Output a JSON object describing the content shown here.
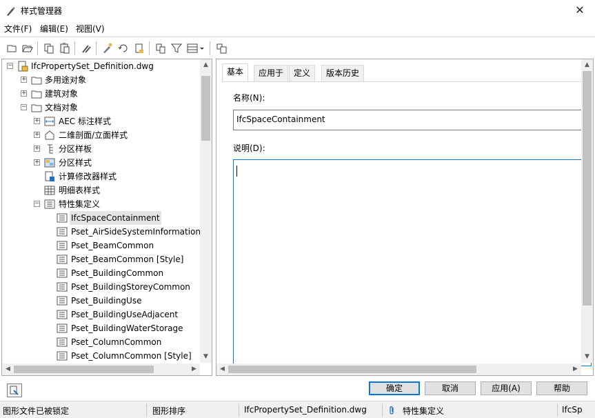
{
  "window": {
    "title": "样式管理器",
    "close_glyph": "✕"
  },
  "menu": [
    "文件(F)",
    "编辑(E)",
    "视图(V)"
  ],
  "toolbar": {
    "icons": [
      "new-icon",
      "open-icon",
      "copy-icon",
      "paste-icon",
      "purge-icon",
      "edit-style-icon",
      "set-from-icon",
      "edit-icon",
      "sort-icon",
      "filter-icon",
      "view-icon",
      "toggle-view-icon"
    ]
  },
  "tree": {
    "root": "IfcPropertySet_Definition.dwg",
    "nodes": [
      {
        "label": "多用途对象",
        "toggle": "+",
        "level": 1
      },
      {
        "label": "建筑对象",
        "toggle": "+",
        "level": 1
      },
      {
        "label": "文档对象",
        "toggle": "−",
        "level": 1
      },
      {
        "label": "AEC 标注样式",
        "toggle": "+",
        "level": 2
      },
      {
        "label": "二维剖面/立面样式",
        "toggle": "+",
        "level": 2
      },
      {
        "label": "分区样板",
        "toggle": "+",
        "level": 2
      },
      {
        "label": "分区样式",
        "toggle": "+",
        "level": 2
      },
      {
        "label": "计算修改器样式",
        "toggle": "",
        "level": 2
      },
      {
        "label": "明细表样式",
        "toggle": "",
        "level": 2
      },
      {
        "label": "特性集定义",
        "toggle": "−",
        "level": 2
      }
    ],
    "leaves": [
      "IfcSpaceContainment",
      "Pset_AirSideSystemInformation",
      "Pset_BeamCommon",
      "Pset_BeamCommon [Style]",
      "Pset_BuildingCommon",
      "Pset_BuildingStoreyCommon",
      "Pset_BuildingUse",
      "Pset_BuildingUseAdjacent",
      "Pset_BuildingWaterStorage",
      "Pset_ColumnCommon",
      "Pset_ColumnCommon [Style]"
    ],
    "selected": "IfcSpaceContainment"
  },
  "tabs": [
    "基本",
    "应用于",
    "定义",
    "版本历史"
  ],
  "active_tab": "基本",
  "form": {
    "name_label": "名称(N):",
    "name_value": "IfcSpaceContainment",
    "desc_label": "说明(D):",
    "desc_value": ""
  },
  "buttons": {
    "ok": "确定",
    "cancel": "取消",
    "apply": "应用(A)",
    "help": "帮助"
  },
  "status": {
    "lock": "图形文件已被锁定",
    "sort": "图形排序",
    "file": "IfcPropertySet_Definition.dwg",
    "type": "特性集定义",
    "truncated": "IfcSp"
  },
  "colors": {
    "accent": "#0078d7",
    "folder_yellow": "#e8b84a",
    "button_face": "#e1e1e1"
  }
}
